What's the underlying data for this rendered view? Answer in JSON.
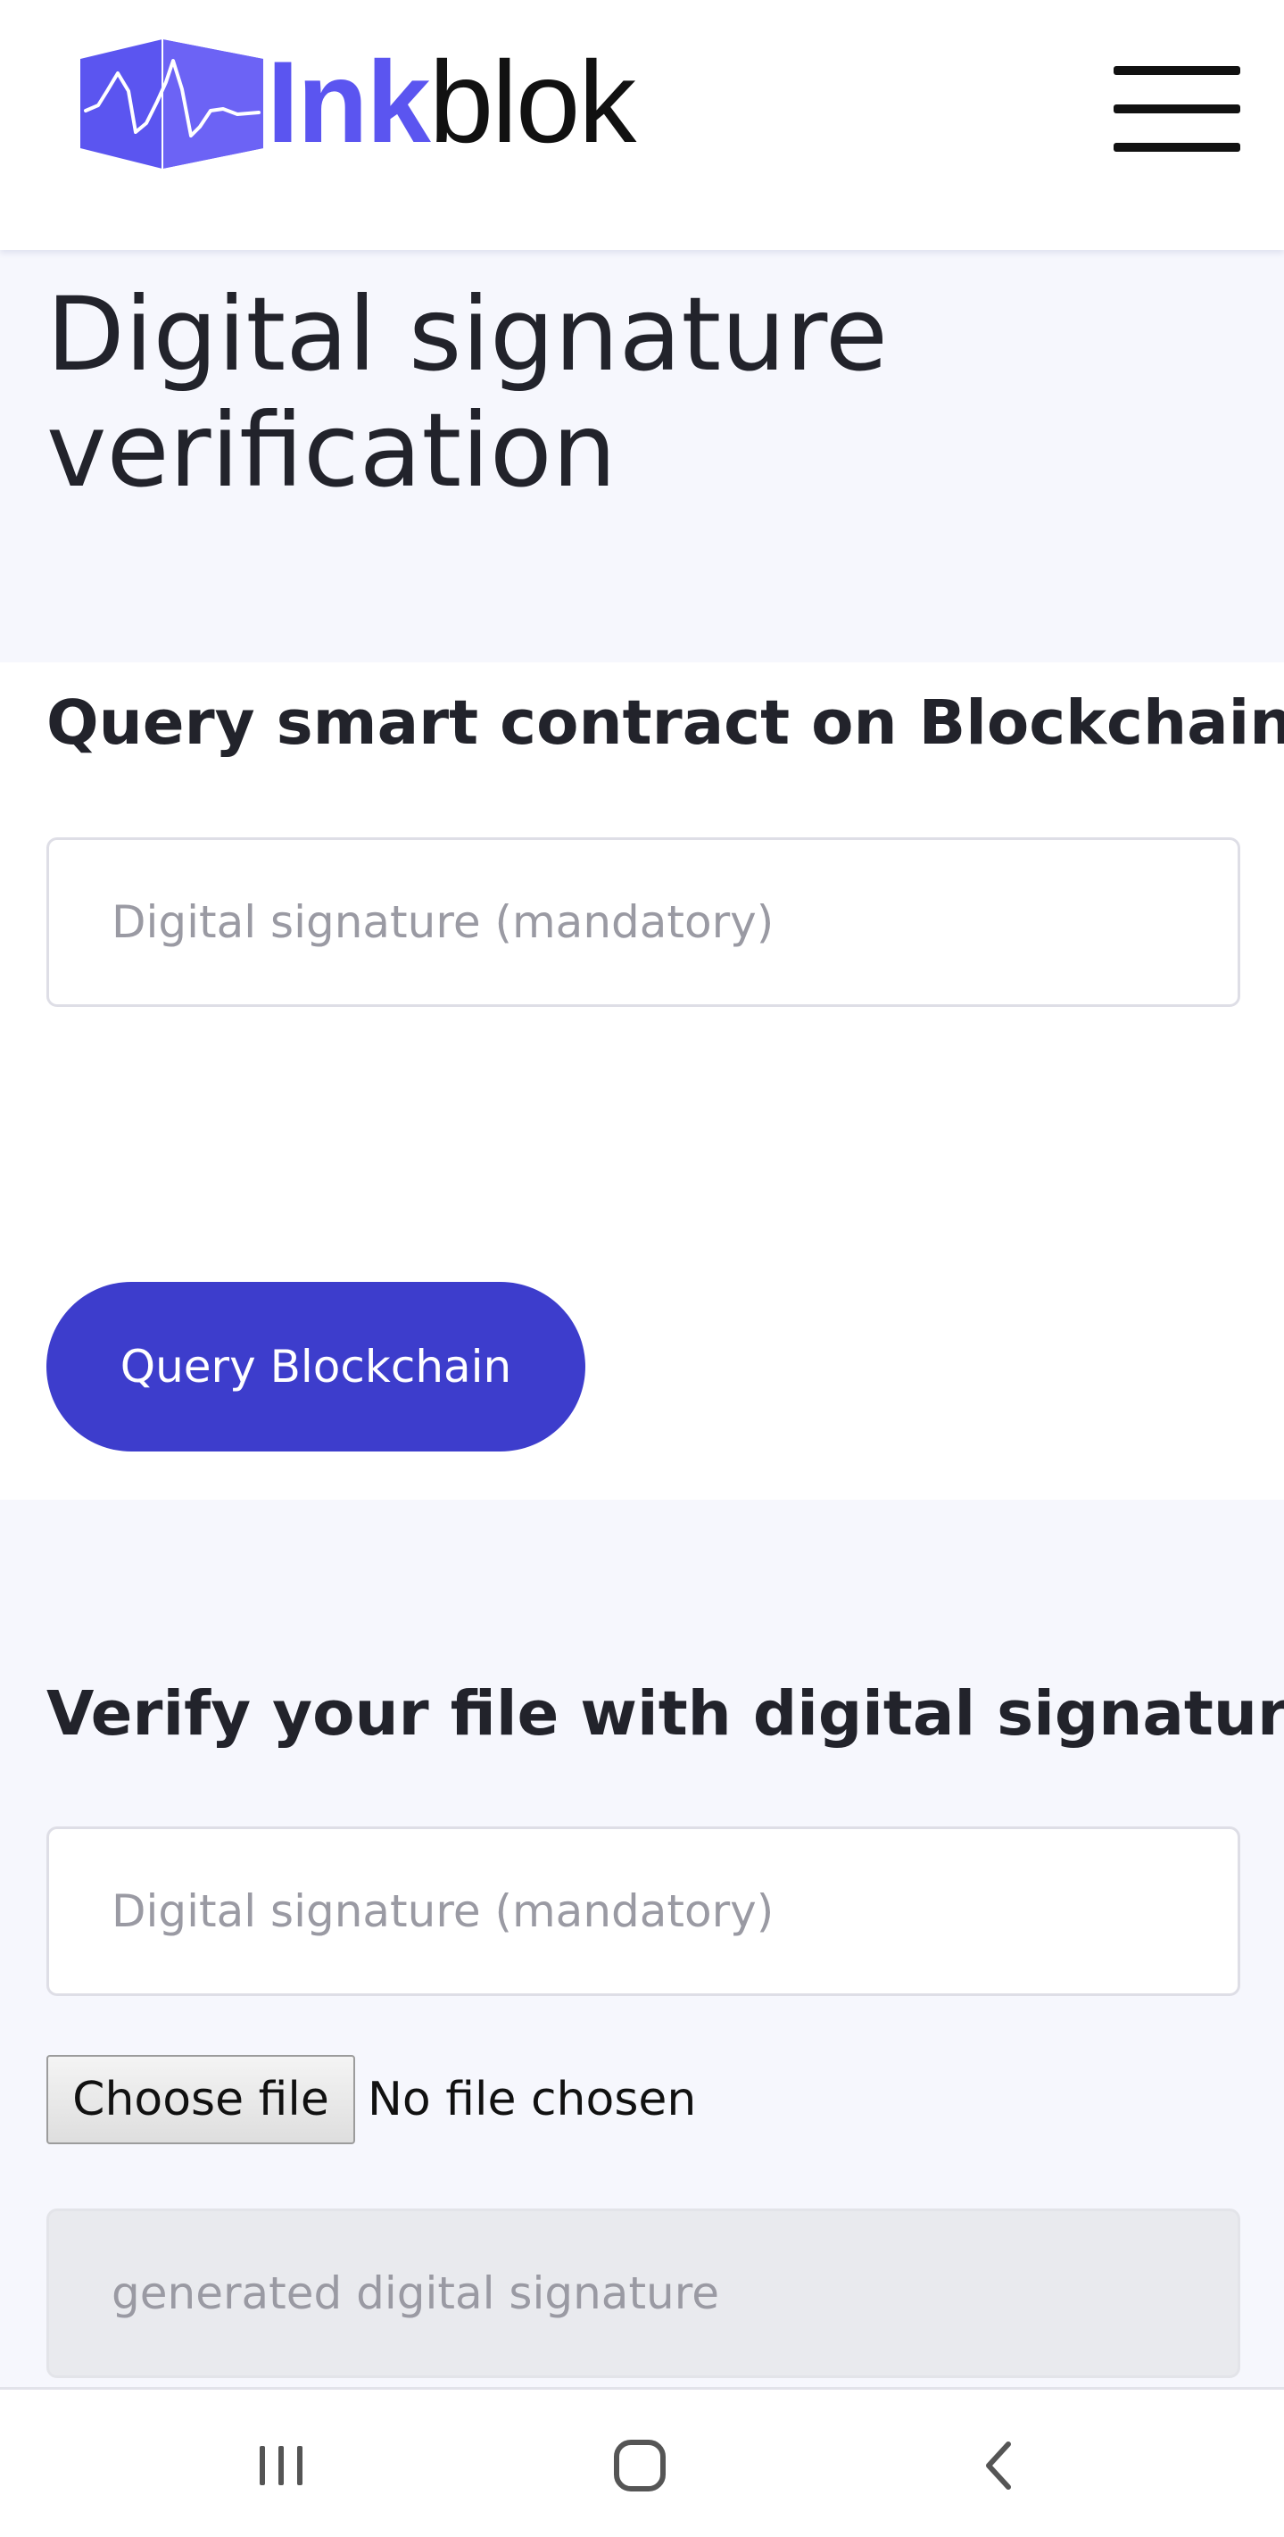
{
  "header": {
    "logo_ink": "Ink",
    "logo_blok": "blok",
    "menu_icon": "hamburger-menu-icon",
    "logo_icon": "waveform-cube-logo"
  },
  "page": {
    "title": "Digital signature verification"
  },
  "query_section": {
    "heading": "Query smart contract on Blockchain",
    "signature_placeholder": "Digital signature (mandatory)",
    "button_label": "Query Blockchain"
  },
  "verify_section": {
    "heading": "Verify your file with digital signature",
    "signature_placeholder": "Digital signature (mandatory)",
    "file_button_label": "Choose file",
    "file_status": "No file chosen",
    "generated_placeholder": "generated digital signature"
  },
  "nav_bar": {
    "icons": [
      "recent-apps-icon",
      "home-icon",
      "back-icon"
    ]
  },
  "colors": {
    "brand": "#5b55f0",
    "button": "#3d3dcc",
    "page_background": "#f6f7fd",
    "text": "#22232b"
  }
}
